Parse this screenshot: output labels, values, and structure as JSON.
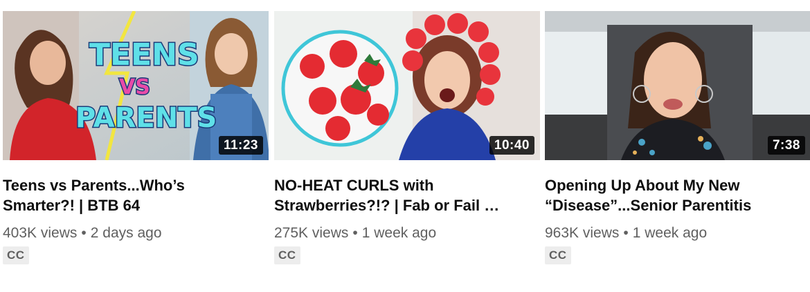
{
  "videos": [
    {
      "title": "Teens vs Parents...Who’s Smarter?! | BTB 64",
      "thumbnail_text": [
        "TEENS",
        "VS",
        "PARENTS"
      ],
      "duration": "11:23",
      "views": "403K views",
      "age": "2 days ago",
      "badge": "CC"
    },
    {
      "title": "NO-HEAT CURLS with Strawberries?!? | Fab or Fail …",
      "duration": "10:40",
      "views": "275K views",
      "age": "1 week ago",
      "badge": "CC"
    },
    {
      "title": "Opening Up About My New “Disease”...Senior Parentitis",
      "duration": "7:38",
      "views": "963K views",
      "age": "1 week ago",
      "badge": "CC"
    }
  ],
  "separator": "•",
  "icons": {
    "thumb1": "teens-vs-parents-thumbnail",
    "thumb2": "strawberry-curls-thumbnail",
    "thumb3": "car-selfie-thumbnail"
  }
}
